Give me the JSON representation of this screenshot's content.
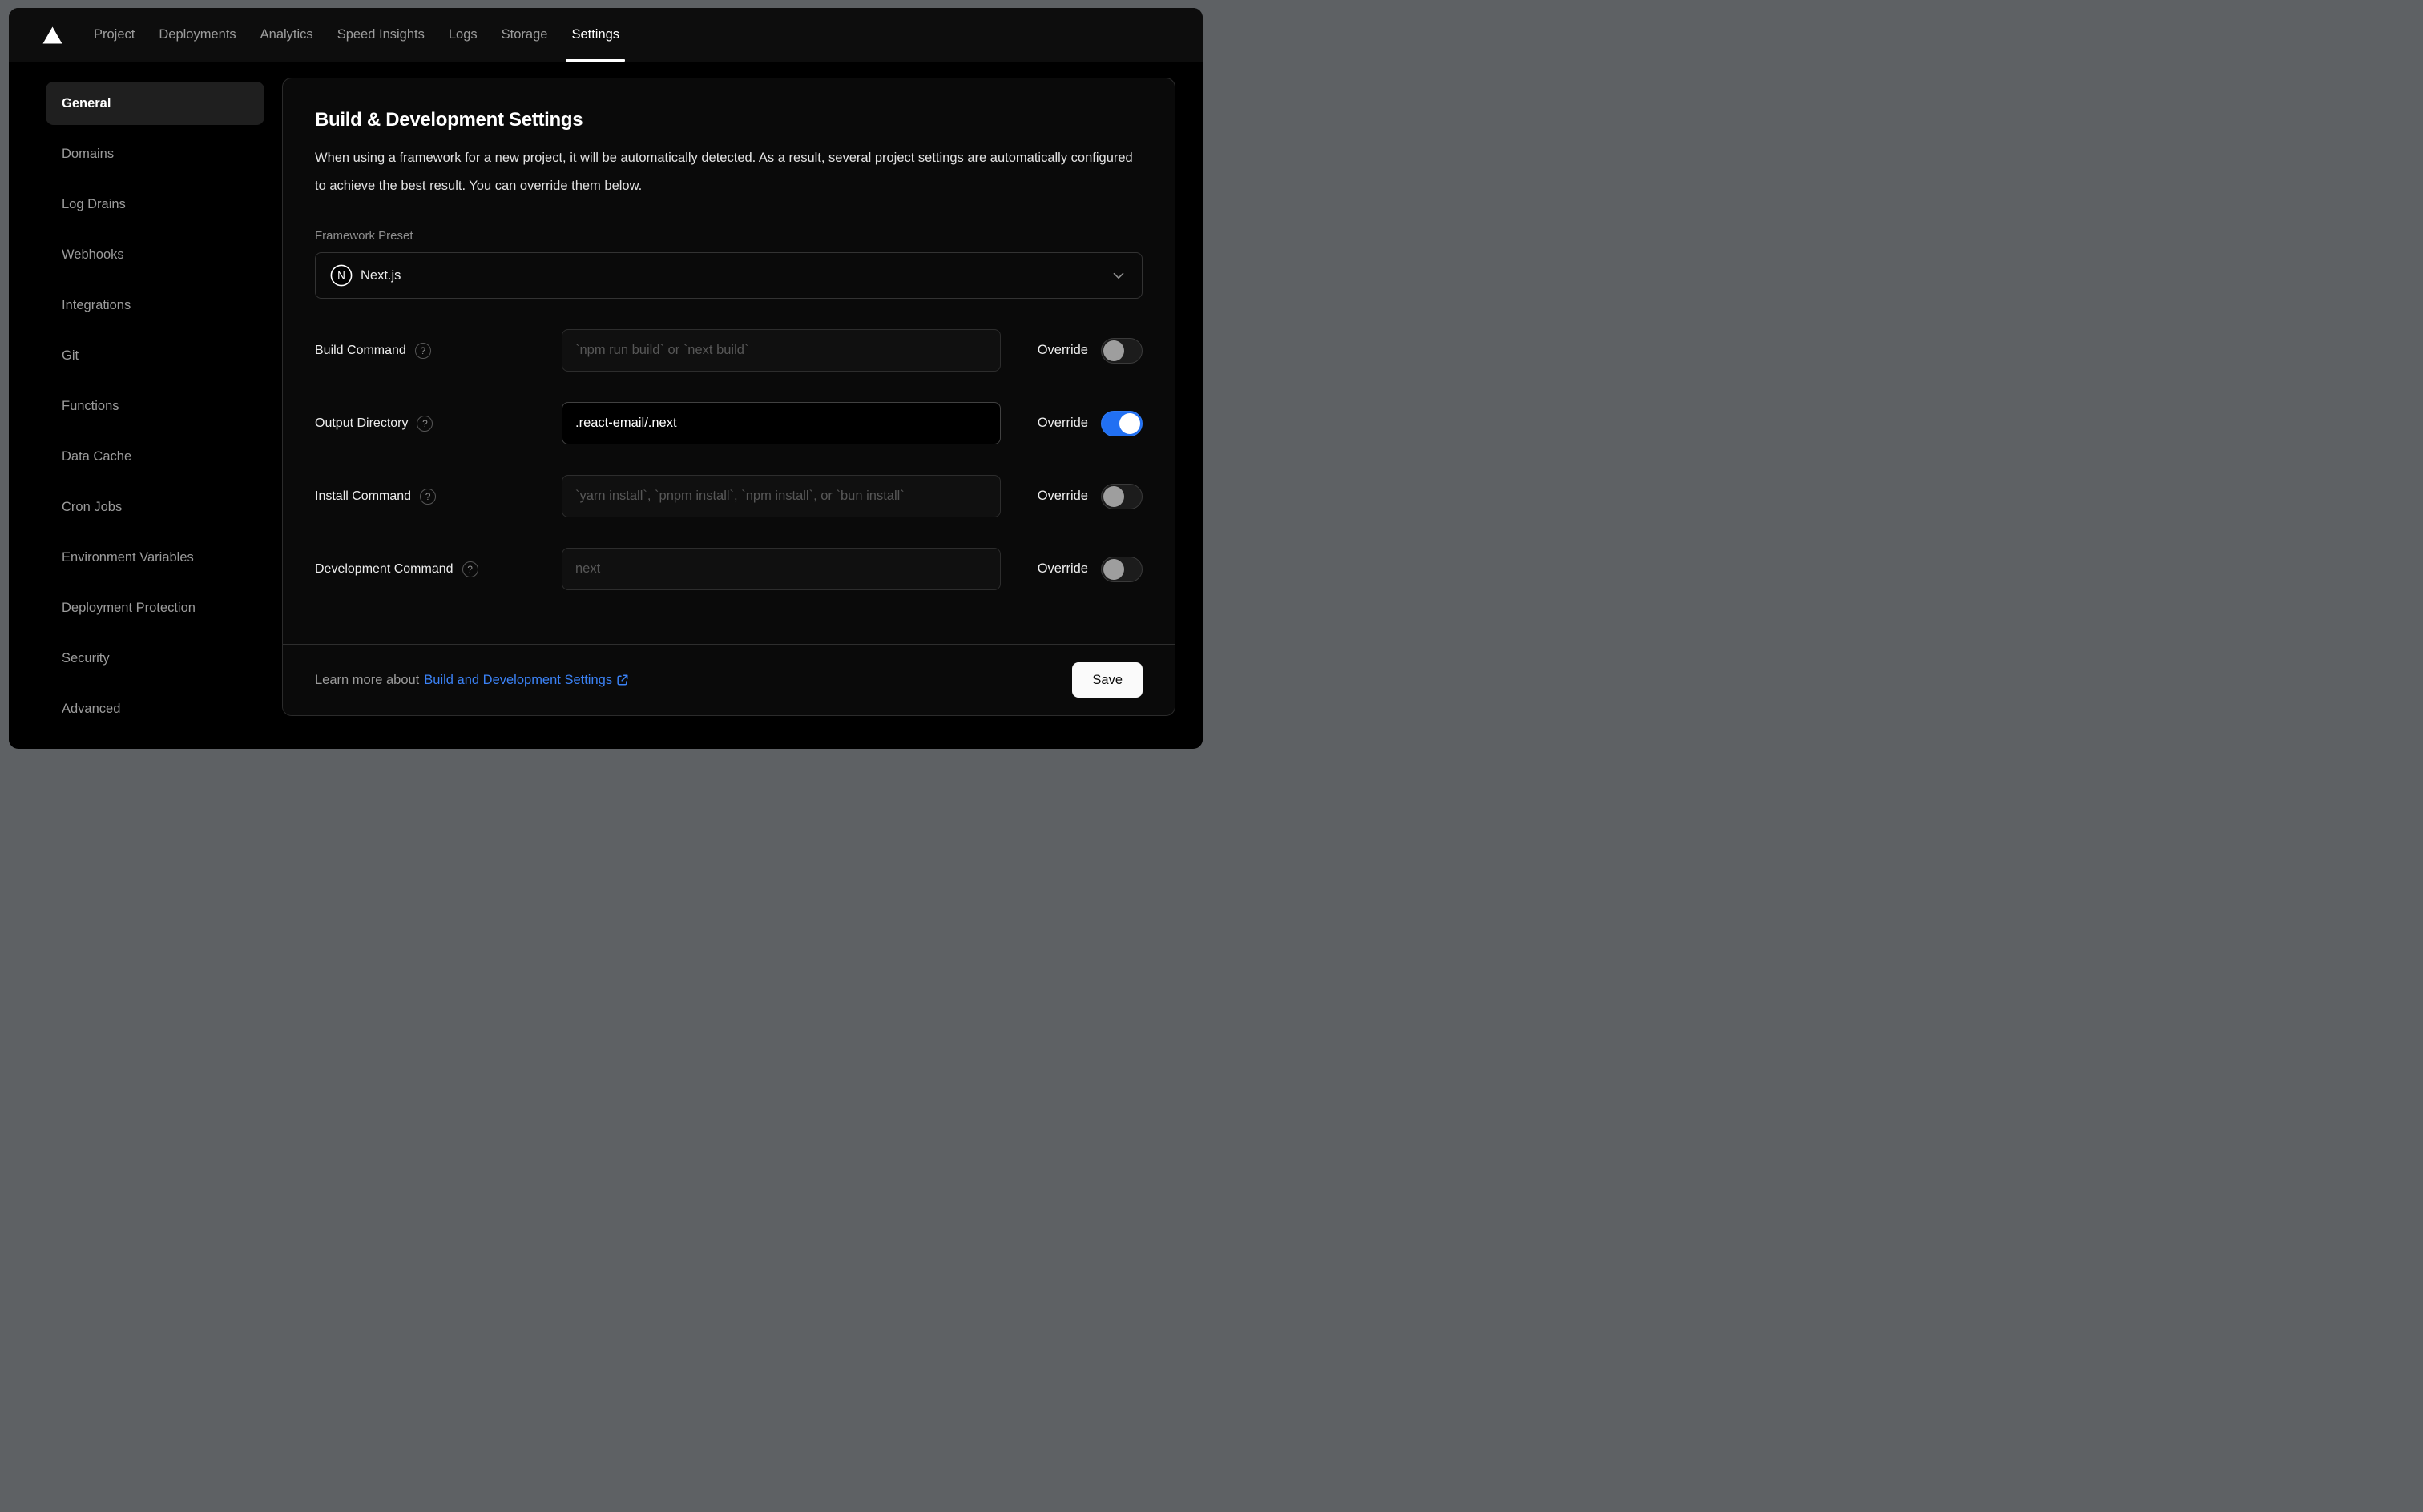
{
  "nav": {
    "items": [
      {
        "label": "Project"
      },
      {
        "label": "Deployments"
      },
      {
        "label": "Analytics"
      },
      {
        "label": "Speed Insights"
      },
      {
        "label": "Logs"
      },
      {
        "label": "Storage"
      },
      {
        "label": "Settings",
        "active": true
      }
    ]
  },
  "sidebar": {
    "items": [
      {
        "label": "General",
        "active": true
      },
      {
        "label": "Domains"
      },
      {
        "label": "Log Drains"
      },
      {
        "label": "Webhooks"
      },
      {
        "label": "Integrations"
      },
      {
        "label": "Git"
      },
      {
        "label": "Functions"
      },
      {
        "label": "Data Cache"
      },
      {
        "label": "Cron Jobs"
      },
      {
        "label": "Environment Variables"
      },
      {
        "label": "Deployment Protection"
      },
      {
        "label": "Security"
      },
      {
        "label": "Advanced"
      }
    ]
  },
  "panel": {
    "title": "Build & Development Settings",
    "description": "When using a framework for a new project, it will be automatically detected. As a result, several project settings are automatically configured to achieve the best result. You can override them below.",
    "framework_preset": {
      "label": "Framework Preset",
      "value": "Next.js"
    },
    "override_label": "Override",
    "rows": [
      {
        "label": "Build Command",
        "placeholder": "`npm run build` or `next build`",
        "value": "",
        "override": false
      },
      {
        "label": "Output Directory",
        "placeholder": "",
        "value": ".react-email/.next",
        "override": true
      },
      {
        "label": "Install Command",
        "placeholder": "`yarn install`, `pnpm install`, `npm install`, or `bun install`",
        "value": "",
        "override": false
      },
      {
        "label": "Development Command",
        "placeholder": "next",
        "value": "",
        "override": false
      }
    ],
    "footer": {
      "learn_more_prefix": "Learn more about",
      "link_text": "Build and Development Settings",
      "save_label": "Save"
    }
  },
  "icons": {
    "logo": "vercel-triangle",
    "framework": "nextjs-circle-n",
    "select": "chevron-down",
    "help": "question-mark-circle",
    "link": "external-link"
  },
  "colors": {
    "toggle_on": "#2170f3",
    "link_blue": "#3b82f6",
    "background": "#000000",
    "card": "#0a0a0a"
  }
}
